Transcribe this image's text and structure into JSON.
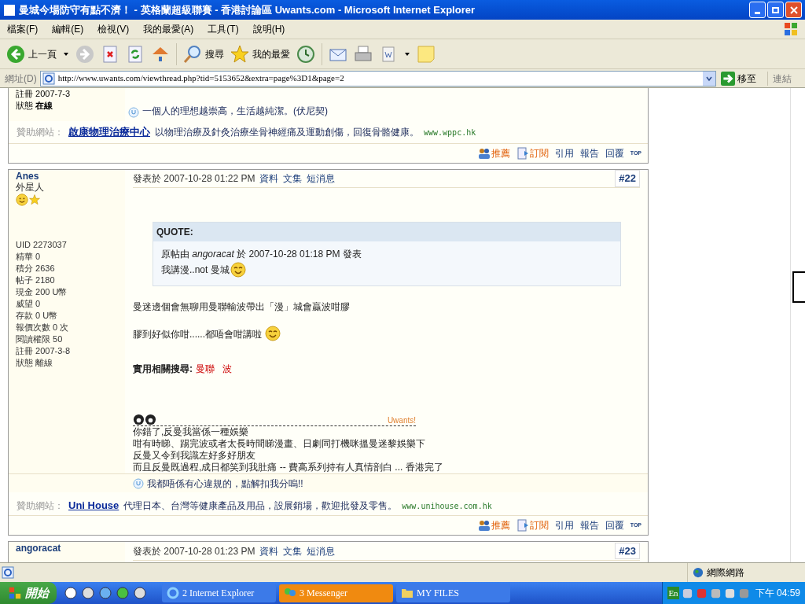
{
  "window": {
    "title": "曼城今場防守有點不濟！ - 英格蘭超級聯賽 - 香港討論區 Uwants.com - Microsoft Internet Explorer"
  },
  "menu_bar": [
    "檔案(F)",
    "編輯(E)",
    "檢視(V)",
    "我的最愛(A)",
    "工具(T)",
    "說明(H)"
  ],
  "toolbar": {
    "back": "上一頁",
    "search": "搜尋",
    "favorites": "我的最愛"
  },
  "address_bar": {
    "label": "網址(D)",
    "url": "http://www.uwants.com/viewthread.php?tid=5153652&extra=page%3D1&page=2",
    "go": "移至",
    "links": "連結"
  },
  "previous_post": {
    "stats": [
      {
        "label": "註冊",
        "value": "2007-7-3"
      }
    ],
    "status": {
      "label": "狀態",
      "value": "在線",
      "online": true
    },
    "signature": "一個人的理想越崇高，生活越純潔。(伏尼契)",
    "sponsor": {
      "label": "贊助網站：",
      "name": "啟康物理治療中心",
      "text": "以物理治療及針灸治療坐骨神經痛及運動創傷，回復骨骼健康。",
      "url": "www.wppc.hk"
    },
    "actions": [
      "推薦",
      "訂閱",
      "引用",
      "報告",
      "回覆"
    ],
    "top": "TOP"
  },
  "post": {
    "author": "Anes",
    "rank": "外星人",
    "stats": [
      {
        "label": "UID",
        "value": "2273037"
      },
      {
        "label": "精華",
        "value": "0"
      },
      {
        "label": "積分",
        "value": "2636"
      },
      {
        "label": "帖子",
        "value": "2180"
      },
      {
        "label": "現金",
        "value": "200 U幣"
      },
      {
        "label": "威望",
        "value": "0"
      },
      {
        "label": "存款",
        "value": "0 U幣"
      },
      {
        "label": "報價次數",
        "value": "0 次"
      },
      {
        "label": "閱讀權限",
        "value": "50"
      },
      {
        "label": "註冊",
        "value": "2007-3-8"
      }
    ],
    "status": {
      "label": "狀態",
      "value": "離線",
      "online": false
    },
    "posted": "發表於 2007-10-28 01:22 PM",
    "links": [
      "資料",
      "文集",
      "短消息"
    ],
    "number": "#22",
    "quote": {
      "title": "QUOTE:",
      "by": "原帖由 *angoracat* 於 2007-10-28 01:18 PM 發表",
      "text": "我講漫..not 曼城"
    },
    "paragraphs": [
      {
        "text": "曼迷邊個會無聊用曼聯輸波帶出「漫」城會贏波咁膠",
        "emoticon": false
      },
      {
        "text": "膠到好似你咁......都唔會咁講啦",
        "emoticon": true
      }
    ],
    "related": {
      "label": "實用相關搜尋:",
      "tags": [
        "曼聯",
        "波"
      ]
    },
    "signature_badge": "Uwants!",
    "signature_lines": [
      "你錯了,反曼我當係一種娛樂",
      "咁有時睇、踢完波或者太長時間睇漫畫、日劇同打機咪搵曼迷黎娛樂下",
      "反曼又令到我識左好多好朋友",
      "而且反曼既過程,成日都笑到我肚痛 -- 費高系列持有人真情剖白 ... 香港完了"
    ],
    "signature": "我都唔係有心違規的，點解扣我分嗚!!",
    "sponsor": {
      "label": "贊助網站：",
      "name": "Uni House",
      "text": "代理日本、台灣等健康產品及用品，設展銷場，歡迎批發及零售。",
      "url": "www.unihouse.com.hk"
    },
    "actions": [
      "推薦",
      "訂閱",
      "引用",
      "報告",
      "回覆"
    ],
    "top": "TOP"
  },
  "next_post": {
    "author": "angoracat",
    "posted": "發表於 2007-10-28 01:23 PM",
    "links": [
      "資料",
      "文集",
      "短消息"
    ],
    "number": "#23"
  },
  "status_bar": {
    "zone": "網際網路"
  },
  "taskbar": {
    "start": "開始",
    "tasks": [
      {
        "label": "2 Internet Explorer",
        "selected": false,
        "kind": "ie"
      },
      {
        "label": "3 Messenger",
        "selected": true,
        "kind": "messenger"
      },
      {
        "label": "MY FILES",
        "selected": false,
        "kind": "folder"
      }
    ],
    "language": "En",
    "clock": "下午 04:59"
  }
}
